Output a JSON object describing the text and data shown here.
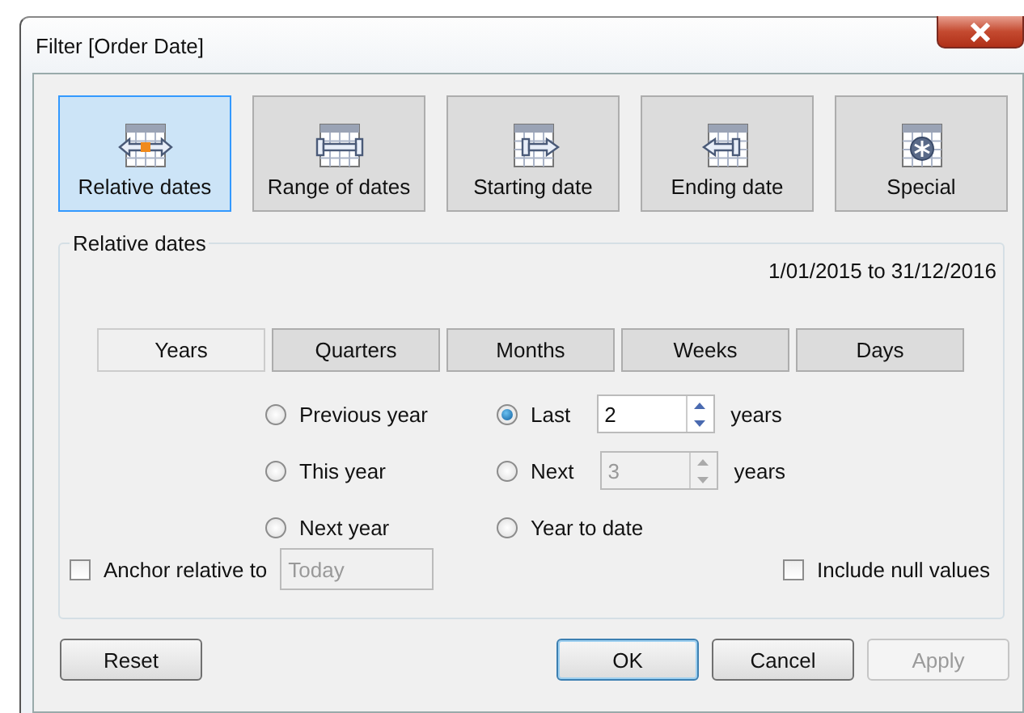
{
  "window": {
    "title": "Filter [Order Date]"
  },
  "modes": [
    {
      "label": "Relative dates",
      "kind": "relative",
      "selected": true
    },
    {
      "label": "Range of dates",
      "kind": "range",
      "selected": false
    },
    {
      "label": "Starting date",
      "kind": "starting",
      "selected": false
    },
    {
      "label": "Ending date",
      "kind": "ending",
      "selected": false
    },
    {
      "label": "Special",
      "kind": "special",
      "selected": false
    }
  ],
  "group": {
    "title": "Relative dates",
    "range_text": "1/01/2015 to 31/12/2016"
  },
  "units": [
    {
      "label": "Years",
      "selected": true
    },
    {
      "label": "Quarters",
      "selected": false
    },
    {
      "label": "Months",
      "selected": false
    },
    {
      "label": "Weeks",
      "selected": false
    },
    {
      "label": "Days",
      "selected": false
    }
  ],
  "options": [
    {
      "label": "Previous year",
      "kind": "plain",
      "selected": false
    },
    {
      "label": "Last",
      "kind": "count",
      "selected": true,
      "value": "2",
      "unit": "years",
      "disabled": false
    },
    {
      "label": "This year",
      "kind": "plain",
      "selected": false
    },
    {
      "label": "Next",
      "kind": "count",
      "selected": false,
      "value": "3",
      "unit": "years",
      "disabled": true
    },
    {
      "label": "Next year",
      "kind": "plain",
      "selected": false
    },
    {
      "label": "Year to date",
      "kind": "plain",
      "selected": false
    }
  ],
  "anchor": {
    "label": "Anchor relative to",
    "checked": false,
    "value": "Today",
    "disabled": true
  },
  "include_null": {
    "label": "Include null values",
    "checked": false
  },
  "buttons": [
    {
      "label": "Reset",
      "default": false,
      "disabled": false
    },
    {
      "label": "OK",
      "default": true,
      "disabled": false
    },
    {
      "label": "Cancel",
      "default": false,
      "disabled": false
    },
    {
      "label": "Apply",
      "default": false,
      "disabled": true
    }
  ]
}
